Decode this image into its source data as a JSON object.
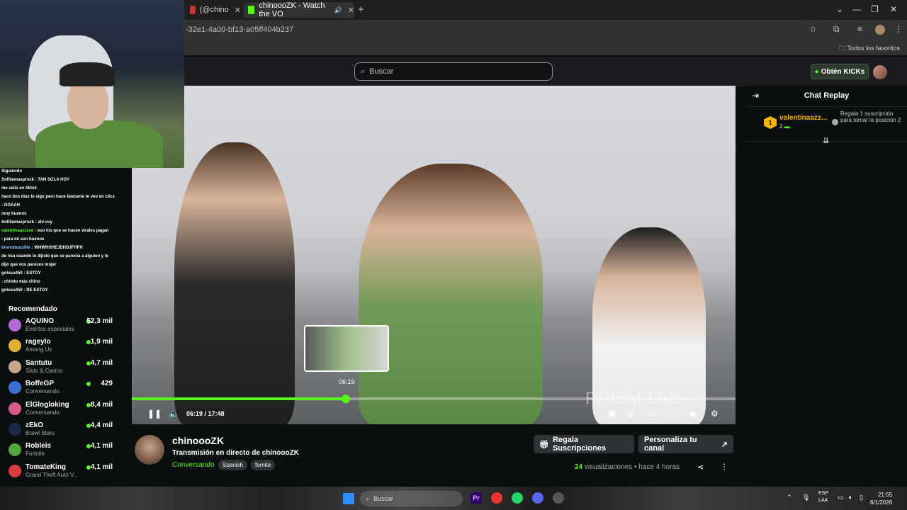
{
  "browser": {
    "tabs": [
      {
        "label": "(@chino",
        "active": false
      },
      {
        "label": "chinoooZK - Watch the VO",
        "active": true
      }
    ],
    "url": "-32e1-4a00-bf13-a05ff404b237",
    "bookmarks_label": "Todos los favoritos"
  },
  "kick": {
    "search_placeholder": "Buscar",
    "get_kicks": "Obtén KICKs"
  },
  "video": {
    "current_time": "06:19",
    "duration": "17:48",
    "time_display": "06:19 / 17:48",
    "preview_time": "06:19",
    "progress": 0.355,
    "watermark": "PRISM Live"
  },
  "overlay_chat": [
    {
      "user": "Siguiendo",
      "text": ""
    },
    {
      "user": "",
      "text": "Sofiilamasprozk : TAN SOLA HOY"
    },
    {
      "user": "",
      "text": "me salis en tiktok"
    },
    {
      "user": "",
      "text": "hace dos días te sigo pero hace bastante te veo en clics"
    },
    {
      "user": "",
      "text": ": OOAAH"
    },
    {
      "user": "",
      "text": "muy buenos"
    },
    {
      "user": "",
      "text": "Sofiilamasprozk : ahí voy"
    },
    {
      "user": "valentinaazzzoe",
      "text": ": eso los que se hacen virales pagan"
    },
    {
      "user": "",
      "text": ": para mi son buenos"
    },
    {
      "user": "brunomuzzillo",
      "text": ": WHWHHHEJDHDJFHFH"
    },
    {
      "user": "",
      "text": "de risa cuando le dijiste que se parecia a alguien y te"
    },
    {
      "user": "",
      "text": "dijo que vos pareces mujer"
    },
    {
      "user": "golusu450",
      "text": ": ESTOY"
    },
    {
      "user": "",
      "text": ": chinito más chino"
    },
    {
      "user": "golusu450",
      "text": ": RE ESTOY"
    }
  ],
  "sidebar": {
    "recommended_label": "Recomendado",
    "channels": [
      {
        "name": "AQUINO",
        "category": "Eventos especiales",
        "viewers": "52,3 mil",
        "color": "#b06bd6"
      },
      {
        "name": "rageylo",
        "category": "Among Us",
        "viewers": "1,9 mil",
        "color": "#e0b030"
      },
      {
        "name": "Santutu",
        "category": "Slots & Casino",
        "viewers": "4,7 mil",
        "color": "#c9a58c"
      },
      {
        "name": "BoffeGP",
        "category": "Conversando",
        "viewers": "429",
        "color": "#3a6fd8"
      },
      {
        "name": "ElGlogloking",
        "category": "Conversando",
        "viewers": "8,4 mil",
        "color": "#d65a8a"
      },
      {
        "name": "zEkO",
        "category": "Brawl Stars",
        "viewers": "4,4 mil",
        "color": "#1b2a49"
      },
      {
        "name": "Robleis",
        "category": "Fortnite",
        "viewers": "4,1 mil",
        "color": "#52a83a"
      },
      {
        "name": "TomateKing",
        "category": "Grand Theft Auto V...",
        "viewers": "4,1 mil",
        "color": "#d63a3a"
      }
    ]
  },
  "chat_replay": {
    "title": "Chat Replay",
    "gifter": {
      "rank": "1",
      "user": "valentinaazz...",
      "count": "2",
      "text": "Regala 1 suscripción para tomar la posición 2"
    }
  },
  "channel": {
    "name": "chinoooZK",
    "stream_title": "Transmisión en directo de chinoooZK",
    "category": "Conversando",
    "tags": [
      "Spanish",
      "fornite"
    ],
    "gift_button": "Regala Suscripciones",
    "customize_button": "Personaliza tu canal",
    "views_count": "24",
    "views_label": "visualizaciones",
    "separator": "•",
    "age": "hace 4 horas"
  },
  "taskbar": {
    "search": "Buscar",
    "lang_top": "ESP",
    "lang_bottom": "LAA",
    "time": "21:55",
    "date": "6/1/2026"
  }
}
